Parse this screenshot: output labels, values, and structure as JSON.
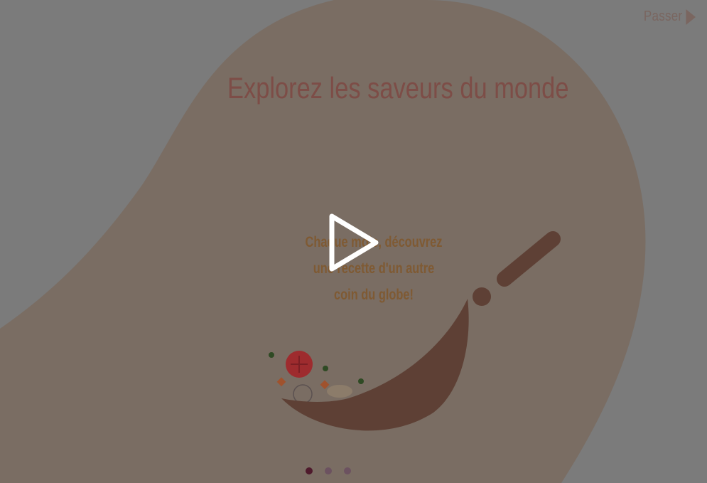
{
  "header": {
    "skip_label": "Passer",
    "skip_icon": "play-triangle-icon"
  },
  "slide": {
    "title": "Explorez les saveurs du monde",
    "subtitle": "Chaque mois, découvrez une recette d'un autre coin du globe!",
    "illustration": "wok-with-vegetables-illustration"
  },
  "video": {
    "play_icon": "play-icon"
  },
  "pagination": {
    "total": 3,
    "active_index": 0
  },
  "colors": {
    "background": "#7b7b7b",
    "blob": "#7a6d63",
    "title": "#7d4d47",
    "subtitle": "#7f5a33",
    "wok": "#5e4035",
    "dot_active": "#4e1a2c",
    "dot_inactive": "#6c5260"
  }
}
